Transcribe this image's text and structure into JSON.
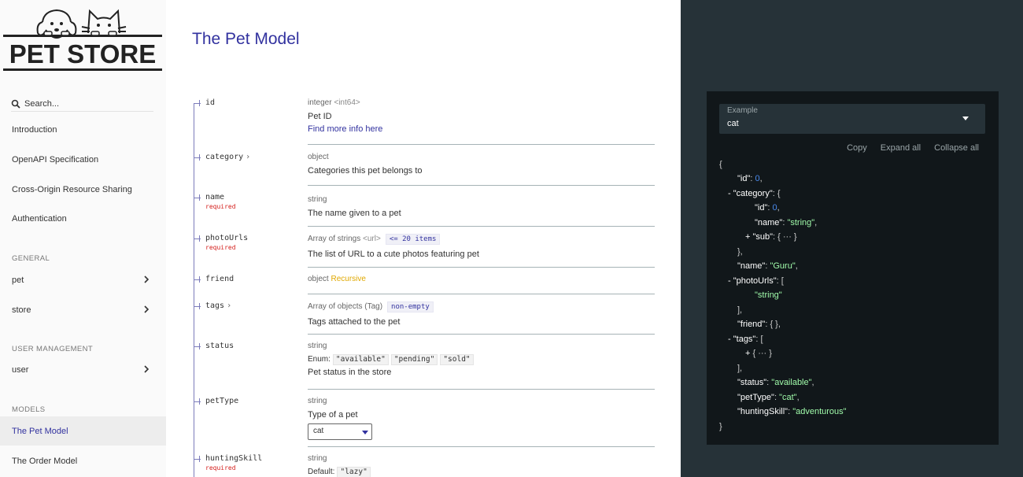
{
  "sidebar": {
    "logo_text": "PET STORE",
    "search_placeholder": "Search...",
    "items": [
      {
        "label": "Introduction"
      },
      {
        "label": "OpenAPI Specification"
      },
      {
        "label": "Cross-Origin Resource Sharing"
      },
      {
        "label": "Authentication"
      }
    ],
    "groups": {
      "general": "GENERAL",
      "user_management": "USER MANAGEMENT",
      "models": "MODELS"
    },
    "general_items": [
      {
        "label": "pet"
      },
      {
        "label": "store"
      }
    ],
    "user_items": [
      {
        "label": "user"
      }
    ],
    "model_items": [
      {
        "label": "The Pet Model",
        "active": true
      },
      {
        "label": "The Order Model"
      }
    ]
  },
  "main": {
    "title": "The Pet Model",
    "properties": [
      {
        "name": "id",
        "required": "",
        "type": "integer",
        "format": "<int64>",
        "desc": "Pet ID",
        "link": "Find more info here"
      },
      {
        "name": "category",
        "type": "object",
        "desc": "Categories this pet belongs to"
      },
      {
        "name": "name",
        "required": "required",
        "type": "string",
        "desc": "The name given to a pet"
      },
      {
        "name": "photoUrls",
        "required": "required",
        "type": "Array of strings",
        "format": "<url>",
        "tag": "<= 20 items",
        "desc": "The list of URL to a cute photos featuring pet"
      },
      {
        "name": "friend",
        "type": "object",
        "recursive": "Recursive"
      },
      {
        "name": "tags",
        "type": "Array of objects (Tag)",
        "tag": "non-empty",
        "desc": "Tags attached to the pet"
      },
      {
        "name": "status",
        "type": "string",
        "enum_label": "Enum:",
        "enum": [
          "\"available\"",
          "\"pending\"",
          "\"sold\""
        ],
        "desc": "Pet status in the store"
      },
      {
        "name": "petType",
        "type": "string",
        "desc": "Type of a pet",
        "select": "cat"
      },
      {
        "name": "huntingSkill",
        "required": "required",
        "type": "string",
        "default_label": "Default:",
        "default": "\"lazy\""
      }
    ]
  },
  "example": {
    "label": "Example",
    "value": "cat",
    "actions": [
      "Copy",
      "Expand all",
      "Collapse all"
    ],
    "code": {
      "open": "{",
      "id_key": "\"id\"",
      "id_val": "0",
      "category_key": "\"category\"",
      "cat_id_key": "\"id\"",
      "cat_id_val": "0",
      "cat_name_key": "\"name\"",
      "cat_name_val": "\"string\"",
      "sub_key": "\"sub\"",
      "sub_val": "{ ··· }",
      "name_key": "\"name\"",
      "name_val": "\"Guru\"",
      "photo_key": "\"photoUrls\"",
      "photo_val": "\"string\"",
      "friend_key": "\"friend\"",
      "friend_val": "{ },",
      "tags_key": "\"tags\"",
      "tags_val": "{ ··· }",
      "status_key": "\"status\"",
      "status_val": "\"available\"",
      "pettype_key": "\"petType\"",
      "pettype_val": "\"cat\"",
      "hunting_key": "\"huntingSkill\"",
      "hunting_val": "\"adventurous\"",
      "close": "}"
    }
  },
  "colors": {
    "accent": "#32329f",
    "required": "#d41f1c",
    "code_bg": "#11171a",
    "panel_bg": "#263238",
    "string": "#a0fbaa",
    "number": "#4a8bee"
  }
}
